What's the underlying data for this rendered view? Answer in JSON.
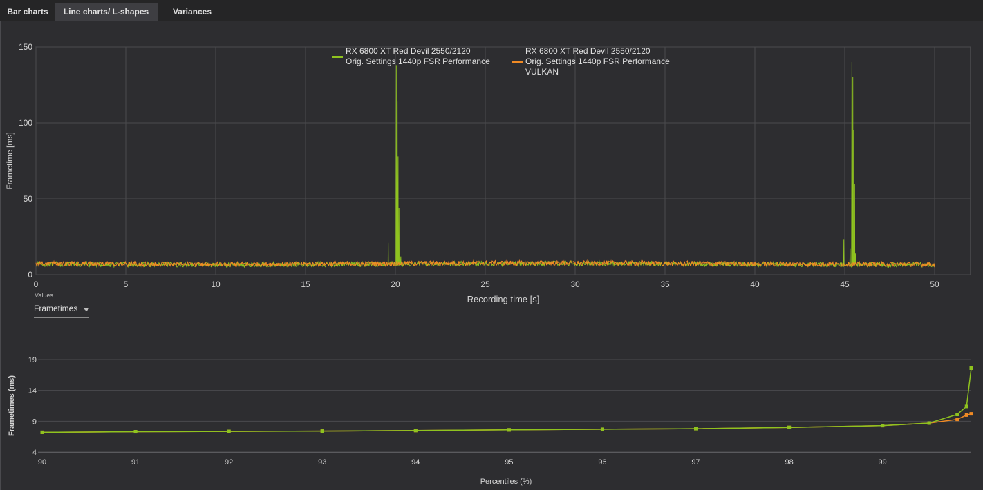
{
  "tabs": [
    {
      "label": "Bar charts",
      "active": false
    },
    {
      "label": "Line charts/ L-shapes",
      "active": true
    },
    {
      "label": "Variances",
      "active": false
    }
  ],
  "values_selector": {
    "label": "Values",
    "selected": "Frametimes"
  },
  "colors": {
    "series1": "#8fc31f",
    "series2": "#f08a24",
    "grid": "#4a4a4e",
    "plot_bg": "#2d2d30"
  },
  "chart_data": [
    {
      "type": "line",
      "xlabel": "Recording time [s]",
      "ylabel": "Frametime [ms]",
      "xlim": [
        0,
        52
      ],
      "ylim": [
        0,
        150
      ],
      "xticks": [
        0,
        5,
        10,
        15,
        20,
        25,
        30,
        35,
        40,
        45,
        50
      ],
      "yticks": [
        0,
        50,
        100,
        150
      ],
      "grid": true,
      "legend": "top-center",
      "series": [
        {
          "name": "RX 6800 XT Red Devil 2550/2120\nOrig. Settings 1440p FSR Performance",
          "color": "#8fc31f",
          "baseline_ms": 7.0,
          "x_end": 50,
          "spikes": [
            {
              "x": 19.6,
              "y": 21
            },
            {
              "x": 20.05,
              "y": 138
            },
            {
              "x": 20.1,
              "y": 114
            },
            {
              "x": 20.15,
              "y": 78
            },
            {
              "x": 20.2,
              "y": 44
            },
            {
              "x": 20.3,
              "y": 12
            },
            {
              "x": 44.95,
              "y": 23
            },
            {
              "x": 45.3,
              "y": 17
            },
            {
              "x": 45.4,
              "y": 140
            },
            {
              "x": 45.45,
              "y": 130
            },
            {
              "x": 45.5,
              "y": 95
            },
            {
              "x": 45.55,
              "y": 60
            },
            {
              "x": 45.6,
              "y": 14
            }
          ]
        },
        {
          "name": "RX 6800 XT Red Devil 2550/2120\nOrig. Settings 1440p FSR Performance\nVULKAN",
          "color": "#f08a24",
          "baseline_ms": 7.3,
          "x_end": 50,
          "spikes": []
        }
      ]
    },
    {
      "type": "line",
      "xlabel": "Percentiles (%)",
      "ylabel": "Frametimes (ms)",
      "xlim": [
        90,
        99.95
      ],
      "ylim": [
        4,
        19
      ],
      "xticks": [
        90,
        91,
        92,
        93,
        94,
        95,
        96,
        97,
        98,
        99
      ],
      "yticks": [
        4,
        9,
        14,
        19
      ],
      "grid": true,
      "series": [
        {
          "color": "#8fc31f",
          "x": [
            90,
            91,
            92,
            93,
            94,
            95,
            96,
            97,
            98,
            99,
            99.5,
            99.8,
            99.9,
            99.95
          ],
          "y": [
            7.2,
            7.3,
            7.35,
            7.4,
            7.5,
            7.6,
            7.7,
            7.8,
            8.0,
            8.3,
            8.7,
            10.1,
            11.4,
            17.6
          ]
        },
        {
          "color": "#f08a24",
          "x": [
            90,
            91,
            92,
            93,
            94,
            95,
            96,
            97,
            98,
            99,
            99.5,
            99.8,
            99.9,
            99.95
          ],
          "y": [
            7.2,
            7.3,
            7.35,
            7.4,
            7.5,
            7.6,
            7.7,
            7.8,
            8.0,
            8.3,
            8.7,
            9.3,
            10.0,
            10.2
          ]
        }
      ]
    }
  ]
}
